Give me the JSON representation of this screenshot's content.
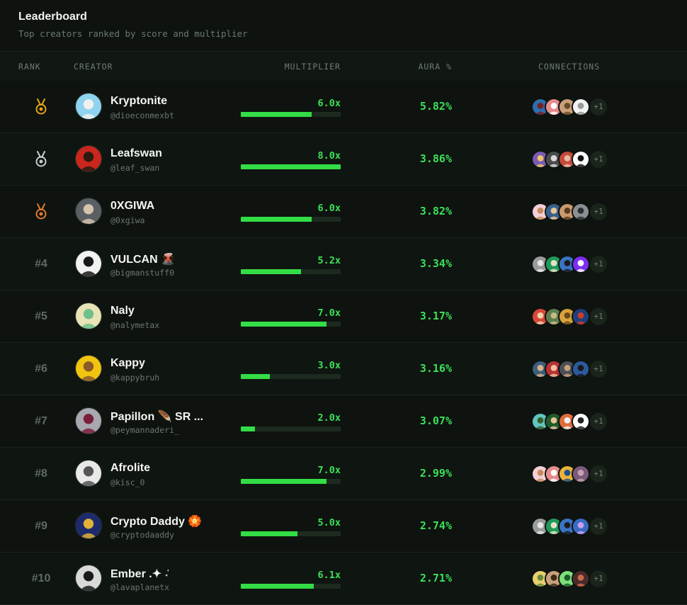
{
  "header": {
    "title": "Leaderboard",
    "subtitle": "Top creators ranked by score and multiplier"
  },
  "columns": {
    "rank": "RANK",
    "creator": "CREATOR",
    "multiplier": "MULTIPLIER",
    "aura": "AURA %",
    "connections": "CONNECTIONS"
  },
  "colors": {
    "accent": "#33dd45",
    "gold": "#e8a317",
    "silver": "#c9cdd2",
    "bronze": "#e07a2c"
  },
  "rows": [
    {
      "rank": "",
      "medal": "gold",
      "name": "Kryptonite",
      "handle": "@dioeconmexbt",
      "multiplier": "6.0x",
      "fill": 0.71,
      "aura": "5.82%",
      "more": "+1",
      "avatar": [
        "#8fd3ee",
        "#f0f0f0"
      ],
      "conns": [
        [
          "#2c6fb0",
          "#7a1e1e"
        ],
        [
          "#e58b8b",
          "#ffffff"
        ],
        [
          "#caa07a",
          "#6b4a2a"
        ],
        [
          "#f2f2f2",
          "#999999"
        ]
      ]
    },
    {
      "rank": "",
      "medal": "silver",
      "name": "Leafswan",
      "handle": "@leaf_swan",
      "multiplier": "8.0x",
      "fill": 1.0,
      "aura": "3.86%",
      "more": "+1",
      "avatar": [
        "#c9261d",
        "#2a1a10"
      ],
      "conns": [
        [
          "#7a5ab5",
          "#e9c46a"
        ],
        [
          "#4b4b4b",
          "#d8d8d8"
        ],
        [
          "#c44b3a",
          "#e8b8a8"
        ],
        [
          "#ffffff",
          "#111111"
        ]
      ]
    },
    {
      "rank": "",
      "medal": "bronze",
      "name": "0XGIWA",
      "handle": "@0xgiwa",
      "multiplier": "6.0x",
      "fill": 0.71,
      "aura": "3.82%",
      "more": "+1",
      "avatar": [
        "#5a5f63",
        "#d7c2b0"
      ],
      "conns": [
        [
          "#f3d0d8",
          "#c98a5b"
        ],
        [
          "#385f8a",
          "#e8c49a"
        ],
        [
          "#c99a6b",
          "#5b3a22"
        ],
        [
          "#8a8f93",
          "#2b2f33"
        ]
      ]
    },
    {
      "rank": "#4",
      "medal": "",
      "name": "VULCAN 🌋",
      "handle": "@bigmanstuff0",
      "multiplier": "5.2x",
      "fill": 0.6,
      "aura": "3.34%",
      "more": "+1",
      "avatar": [
        "#f2f2f2",
        "#1a1a1a"
      ],
      "conns": [
        [
          "#9b9b9b",
          "#e6e6e6"
        ],
        [
          "#1f9a5a",
          "#e8e0c4"
        ],
        [
          "#3a74c4",
          "#1c1c1c"
        ],
        [
          "#7b2ff2",
          "#ffffff"
        ]
      ]
    },
    {
      "rank": "#5",
      "medal": "",
      "name": "Naly",
      "handle": "@nalymetax",
      "multiplier": "7.0x",
      "fill": 0.86,
      "aura": "3.17%",
      "more": "+1",
      "avatar": [
        "#e9e3b8",
        "#6fbf8a"
      ],
      "conns": [
        [
          "#d9473b",
          "#f0d0a8"
        ],
        [
          "#5e7d4d",
          "#c8b98a"
        ],
        [
          "#d9a23b",
          "#6b4a1a"
        ],
        [
          "#1e3f7a",
          "#d23a2a"
        ]
      ]
    },
    {
      "rank": "#6",
      "medal": "",
      "name": "Kappy",
      "handle": "@kappybruh",
      "multiplier": "3.0x",
      "fill": 0.29,
      "aura": "3.16%",
      "more": "+1",
      "avatar": [
        "#f1c40f",
        "#8a5a2b"
      ],
      "conns": [
        [
          "#3d5f7a",
          "#d8b08c"
        ],
        [
          "#b83232",
          "#f0c0a0"
        ],
        [
          "#4a4f58",
          "#c9a07a"
        ],
        [
          "#2c5aa0",
          "#1a1a1a"
        ]
      ]
    },
    {
      "rank": "#7",
      "medal": "",
      "name": "Papillon 🪶 SR ...",
      "handle": "@peymannaderi_",
      "multiplier": "2.0x",
      "fill": 0.14,
      "aura": "3.07%",
      "more": "+1",
      "avatar": [
        "#a8a8b0",
        "#7a1e3a"
      ],
      "conns": [
        [
          "#5fc6c0",
          "#3a5a2a"
        ],
        [
          "#1f5a2a",
          "#e8c49a"
        ],
        [
          "#e06a3b",
          "#f2f2f2"
        ],
        [
          "#ffffff",
          "#222222"
        ]
      ]
    },
    {
      "rank": "#8",
      "medal": "",
      "name": "Afrolite",
      "handle": "@kisc_0",
      "multiplier": "7.0x",
      "fill": 0.86,
      "aura": "2.99%",
      "more": "+1",
      "avatar": [
        "#e9e9e9",
        "#555555"
      ],
      "conns": [
        [
          "#f3d0d8",
          "#c98a5b"
        ],
        [
          "#e58b8b",
          "#ffffff"
        ],
        [
          "#e8b33a",
          "#1e4f8a"
        ],
        [
          "#7a5a7a",
          "#c8a0b0"
        ]
      ]
    },
    {
      "rank": "#9",
      "medal": "",
      "name": "Crypto Daddy 🏵️",
      "handle": "@cryptodaaddy",
      "multiplier": "5.0x",
      "fill": 0.57,
      "aura": "2.74%",
      "more": "+1",
      "avatar": [
        "#1d2a6b",
        "#e0b23a"
      ],
      "conns": [
        [
          "#9b9b9b",
          "#e6e6e6"
        ],
        [
          "#1f9a5a",
          "#e8e0c4"
        ],
        [
          "#3a74c4",
          "#1c1c1c"
        ],
        [
          "#3a6ac4",
          "#c9a0e8"
        ]
      ]
    },
    {
      "rank": "#10",
      "medal": "",
      "name": "Ember .✦ ݁˖",
      "handle": "@lavaplanetx",
      "multiplier": "6.1x",
      "fill": 0.73,
      "aura": "2.71%",
      "more": "+1",
      "avatar": [
        "#d9d9d9",
        "#1a1a1a"
      ],
      "conns": [
        [
          "#e8d070",
          "#6a8a3a"
        ],
        [
          "#c9a07a",
          "#3a2a1a"
        ],
        [
          "#7ce07a",
          "#1f5a2a"
        ],
        [
          "#4a2a2a",
          "#c86a4a"
        ]
      ]
    }
  ]
}
